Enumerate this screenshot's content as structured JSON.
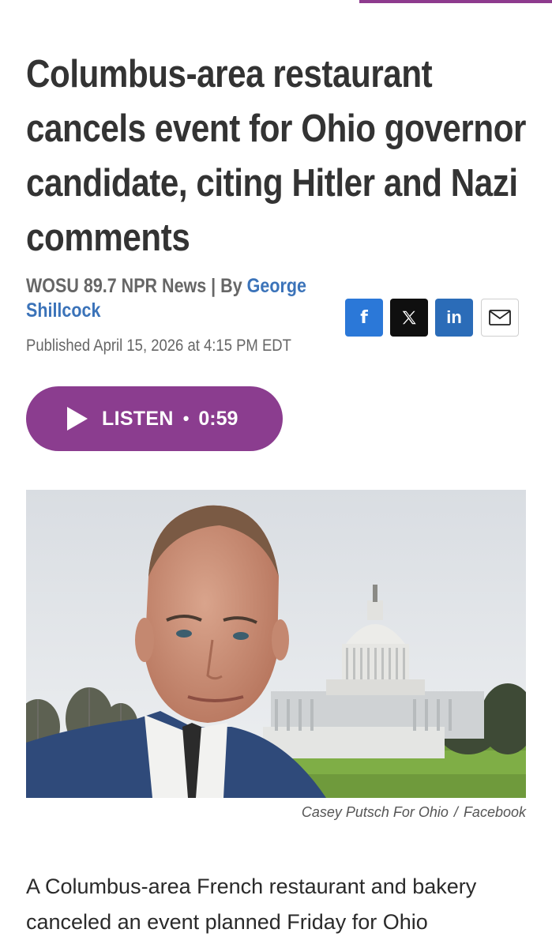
{
  "article": {
    "headline": "Columbus-area restaurant cancels event for Ohio governor candidate, citing Hitler and Nazi comments",
    "source": "WOSU 89.7 NPR News",
    "by_separator": " | By ",
    "author": "George Shillcock",
    "published": "Published April 15, 2026 at 4:15 PM EDT",
    "photo_credit_name": "Casey Putsch For Ohio",
    "photo_credit_separator": "/",
    "photo_credit_source": "Facebook",
    "body_visible": "A Columbus-area French restaurant and bakery canceled an event planned Friday for Ohio"
  },
  "share": {
    "facebook_icon": "f",
    "x_icon": "X",
    "linkedin_icon": "in",
    "email_icon": "envelope-icon"
  },
  "audio": {
    "label": "LISTEN",
    "dot": "•",
    "duration": "0:59"
  },
  "colors": {
    "accent_purple": "#8b3d8f",
    "author_link": "#3b73b9",
    "facebook": "#2b78d8",
    "x": "#0f0f0f",
    "linkedin": "#2b6cb8"
  }
}
